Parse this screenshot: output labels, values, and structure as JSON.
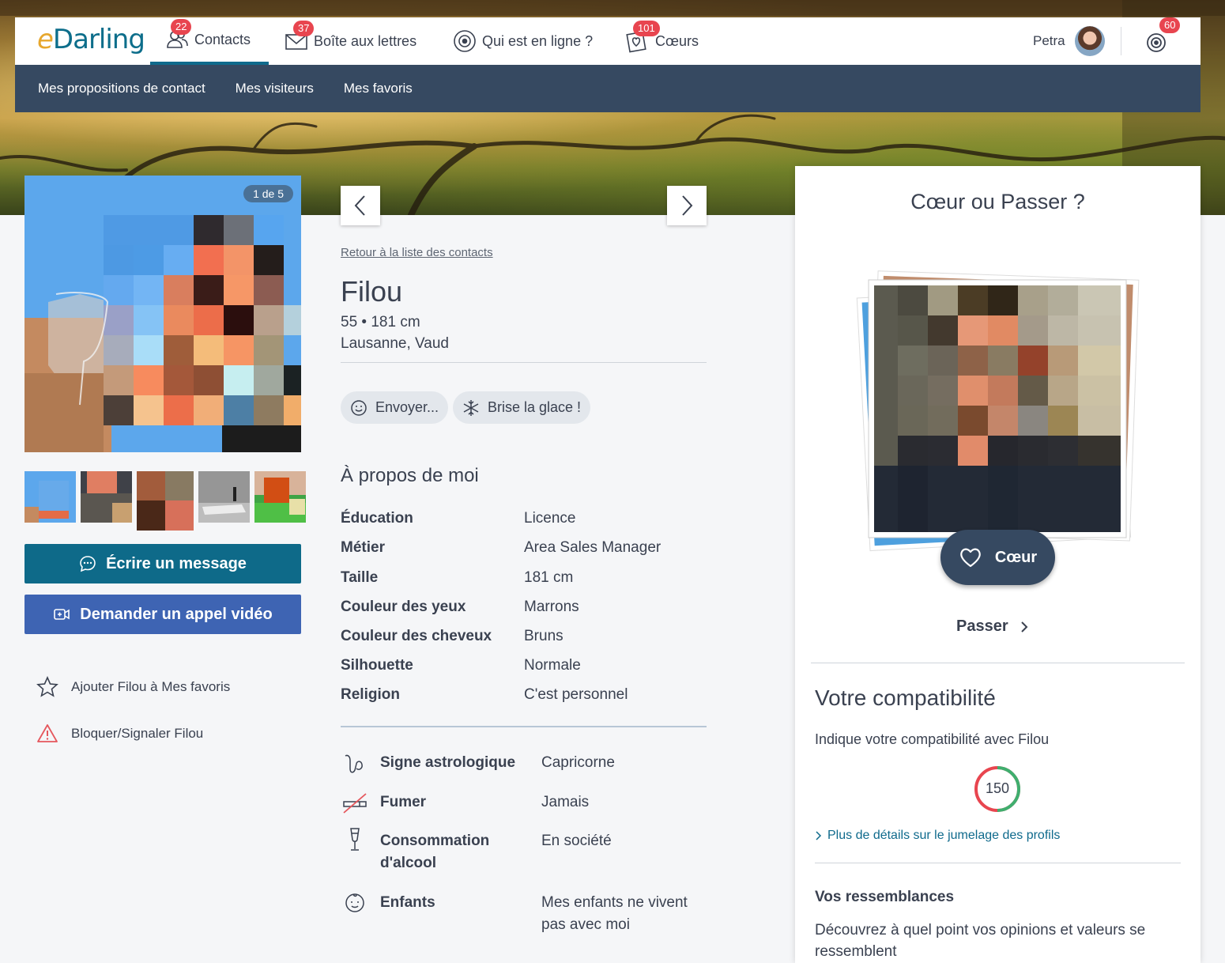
{
  "brand": {
    "logo_e": "e",
    "logo_rest": "Darling"
  },
  "topnav": {
    "items": [
      {
        "label": "Contacts",
        "badge": "22",
        "icon": "contacts-icon"
      },
      {
        "label": "Boîte aux lettres",
        "badge": "37",
        "icon": "mail-icon"
      },
      {
        "label": "Qui est en ligne ?",
        "badge": "",
        "icon": "online-icon"
      },
      {
        "label": "Cœurs",
        "badge": "101",
        "icon": "hearts-icon"
      }
    ],
    "user_name": "Petra",
    "notifications_badge": "60"
  },
  "subnav": {
    "items": [
      "Mes propositions de contact",
      "Mes visiteurs",
      "Mes favoris"
    ]
  },
  "profile": {
    "photo_counter": "1 de 5",
    "name": "Filou",
    "age_height": "55 • 181 cm",
    "location": "Lausanne, Vaud",
    "back_link": "Retour à la liste des contacts",
    "send_label": "Envoyer...",
    "icebreaker_label": "Brise la glace !",
    "write_message": "Écrire un message",
    "video_call": "Demander un appel vidéo",
    "add_favorite": "Ajouter Filou à Mes favoris",
    "block_report": "Bloquer/Signaler Filou"
  },
  "about": {
    "title": "À propos de moi",
    "rows": [
      {
        "k": "Éducation",
        "v": "Licence"
      },
      {
        "k": "Métier",
        "v": "Area Sales Manager"
      },
      {
        "k": "Taille",
        "v": "181 cm"
      },
      {
        "k": "Couleur des yeux",
        "v": "Marrons"
      },
      {
        "k": "Couleur des cheveux",
        "v": "Bruns"
      },
      {
        "k": "Silhouette",
        "v": "Normale"
      },
      {
        "k": "Religion",
        "v": "C'est personnel"
      }
    ],
    "lifestyle": [
      {
        "k": "Signe astrologique",
        "v": "Capricorne",
        "icon": "capricorn-icon"
      },
      {
        "k": "Fumer",
        "v": "Jamais",
        "icon": "no-smoking-icon"
      },
      {
        "k": "Consommation d'alcool",
        "v": "En société",
        "icon": "champagne-glass-icon"
      },
      {
        "k": "Enfants",
        "v": "Mes enfants ne vivent pas avec moi",
        "icon": "child-face-icon"
      }
    ]
  },
  "match": {
    "title": "Cœur ou Passer ?",
    "heart_label": "Cœur",
    "pass_label": "Passer",
    "compat_title": "Votre compatibilité",
    "compat_sub": "Indique votre compatibilité avec Filou",
    "score": "150",
    "details_link": "Plus de détails sur le jumelage des profils",
    "similarities_title": "Vos ressemblances",
    "similarities_sub": "Découvrez à quel point vos opinions et valeurs se ressemblent"
  },
  "colors": {
    "primary": "#0f6a8c",
    "navy": "#364961",
    "video_blue": "#3e64b3",
    "badge_red": "#e8454f"
  }
}
